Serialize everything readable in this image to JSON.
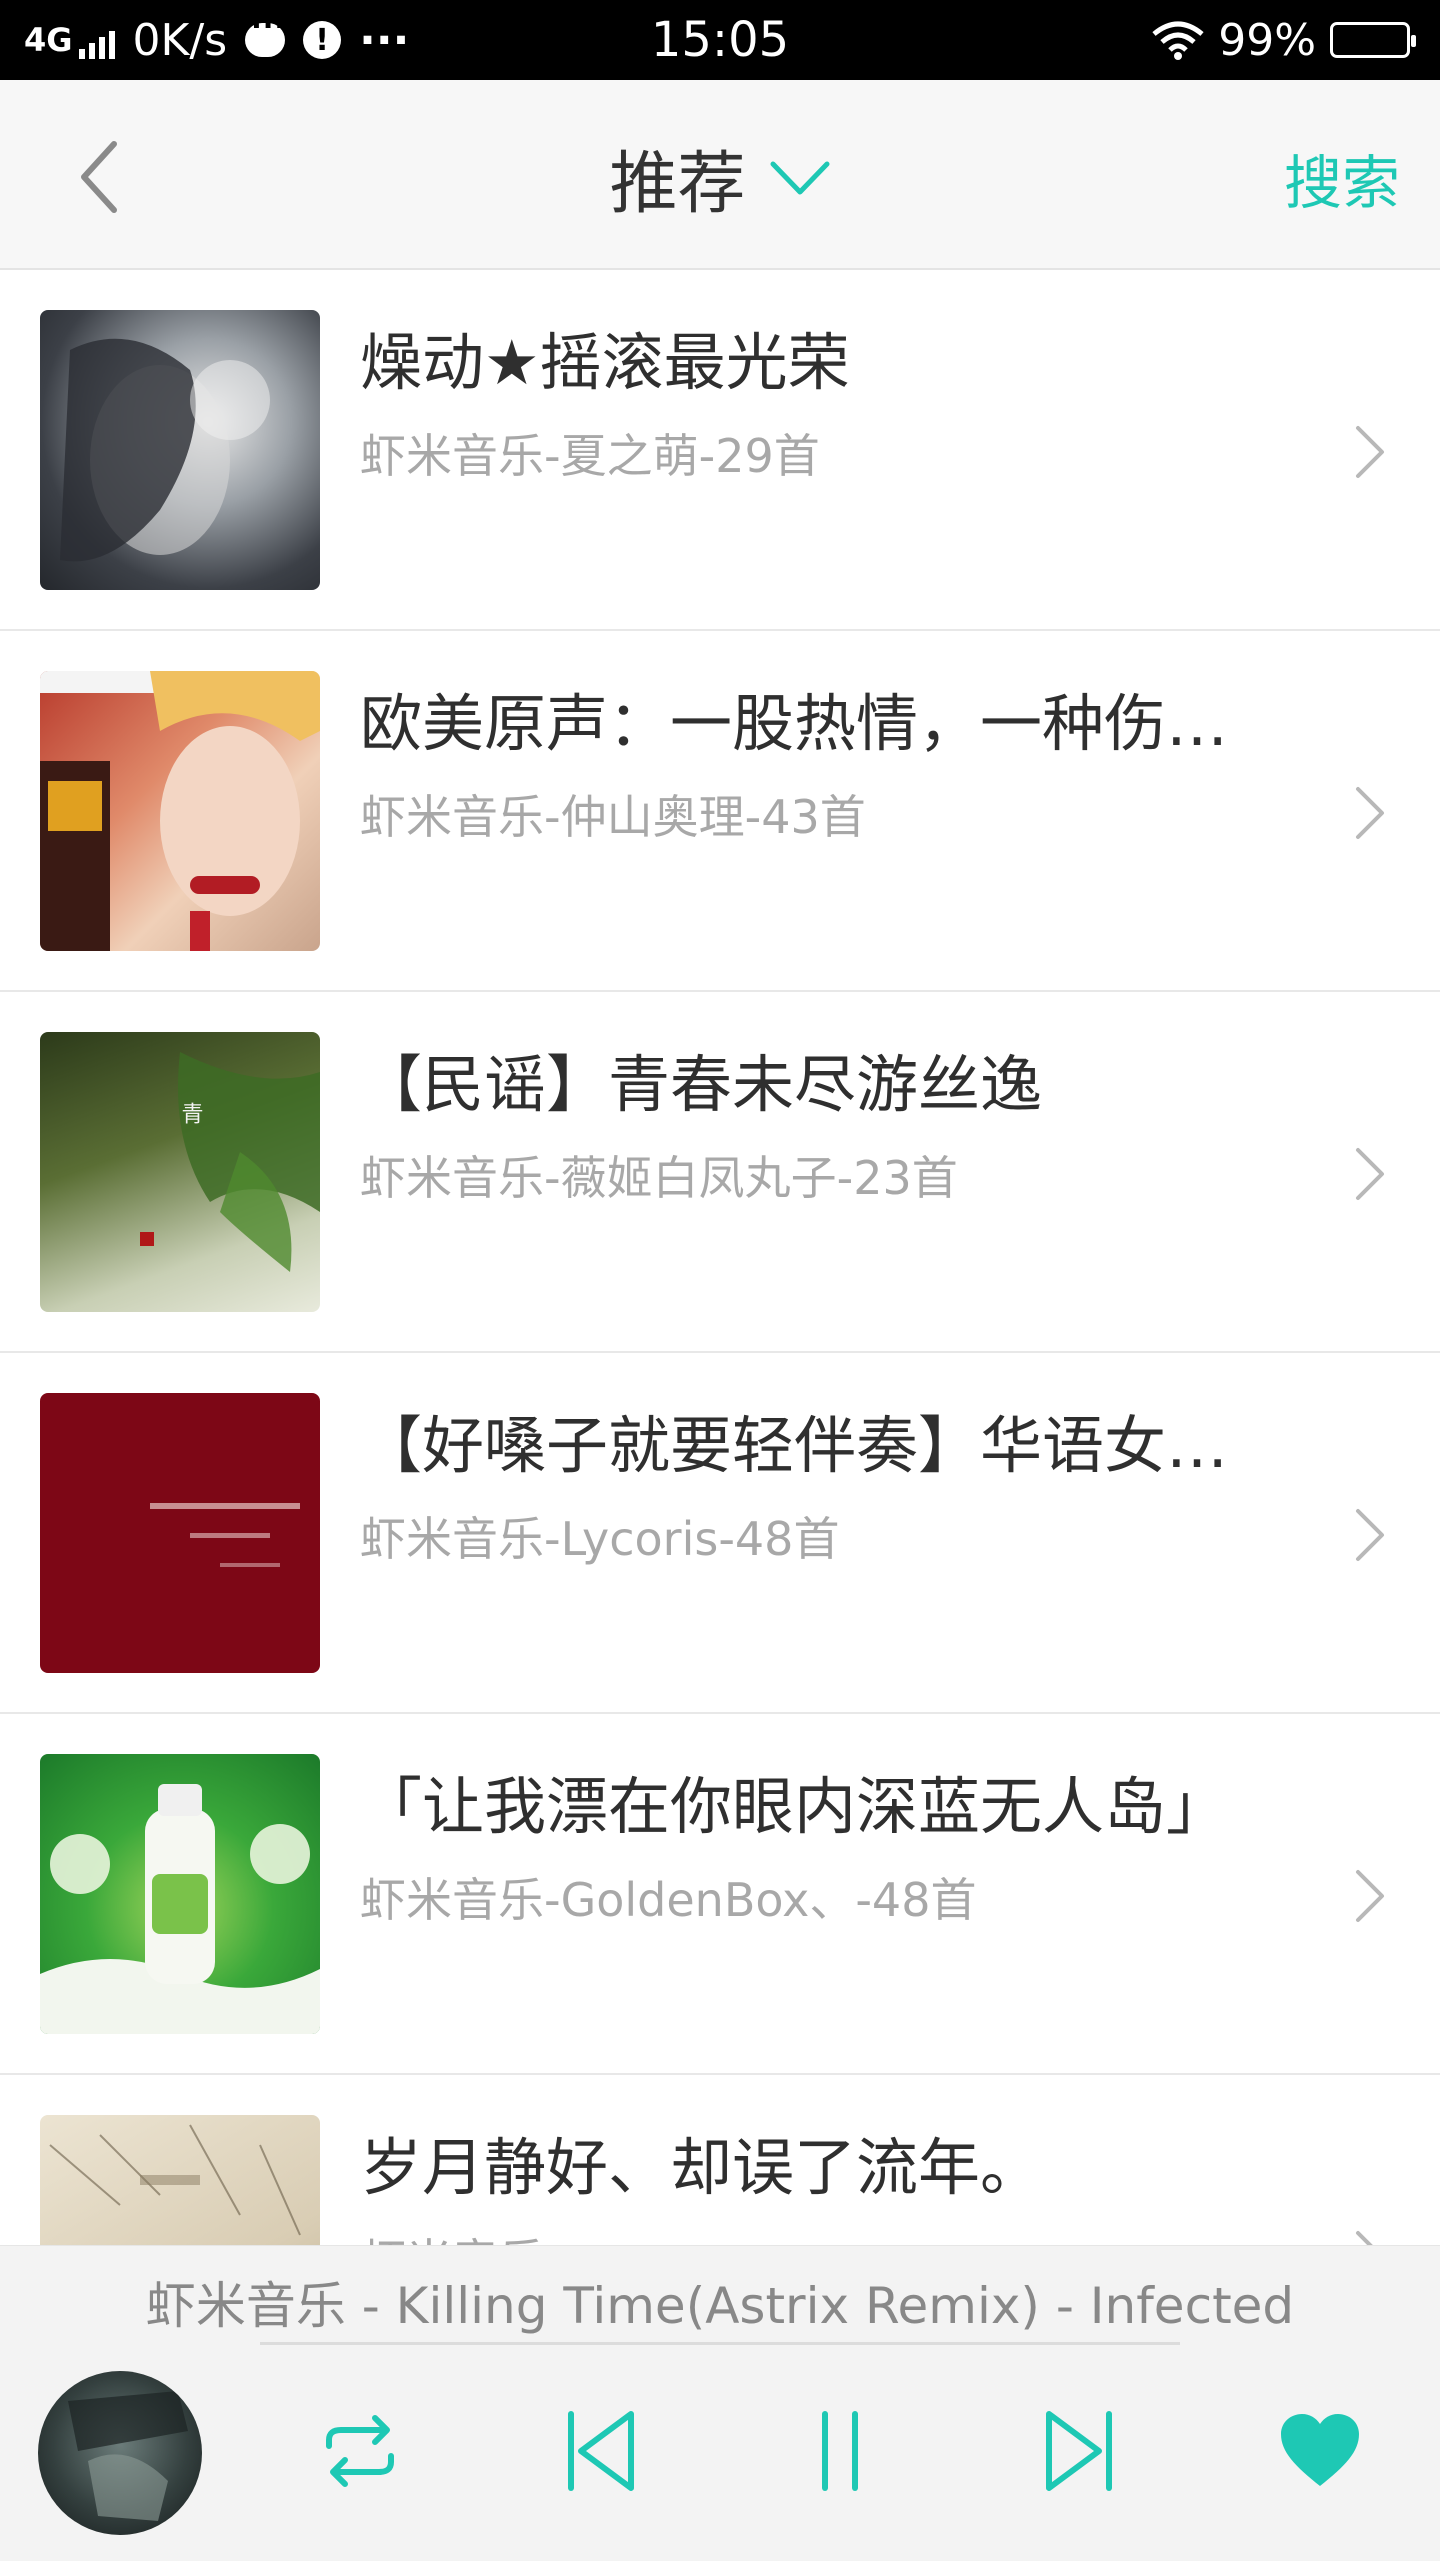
{
  "status_bar": {
    "network": "4G",
    "speed": "0K/s",
    "time": "15:05",
    "battery": "99%"
  },
  "header": {
    "title": "推荐",
    "search": "搜索"
  },
  "playlists": [
    {
      "title": "燥动★摇滚最光荣",
      "subtitle": "虾米音乐-夏之萌-29首"
    },
    {
      "title": "欧美原声：一股热情，一种伤…",
      "subtitle": "虾米音乐-仲山奥理-43首"
    },
    {
      "title": "【民谣】青春未尽游丝逸",
      "subtitle": "虾米音乐-薇姬白凤丸子-23首"
    },
    {
      "title": "【好嗓子就要轻伴奏】华语女…",
      "subtitle": "虾米音乐-Lycoris-48首"
    },
    {
      "title": "「让我漂在你眼内深蓝无人岛」",
      "subtitle": "虾米音乐-GoldenBox、-48首"
    },
    {
      "title": "岁月静好、却误了流年。",
      "subtitle": "虾米音乐-"
    }
  ],
  "player": {
    "now_playing": "虾米音乐 - Killing Time(Astrix Remix) - Infected",
    "accent": "#1ec8b4"
  }
}
